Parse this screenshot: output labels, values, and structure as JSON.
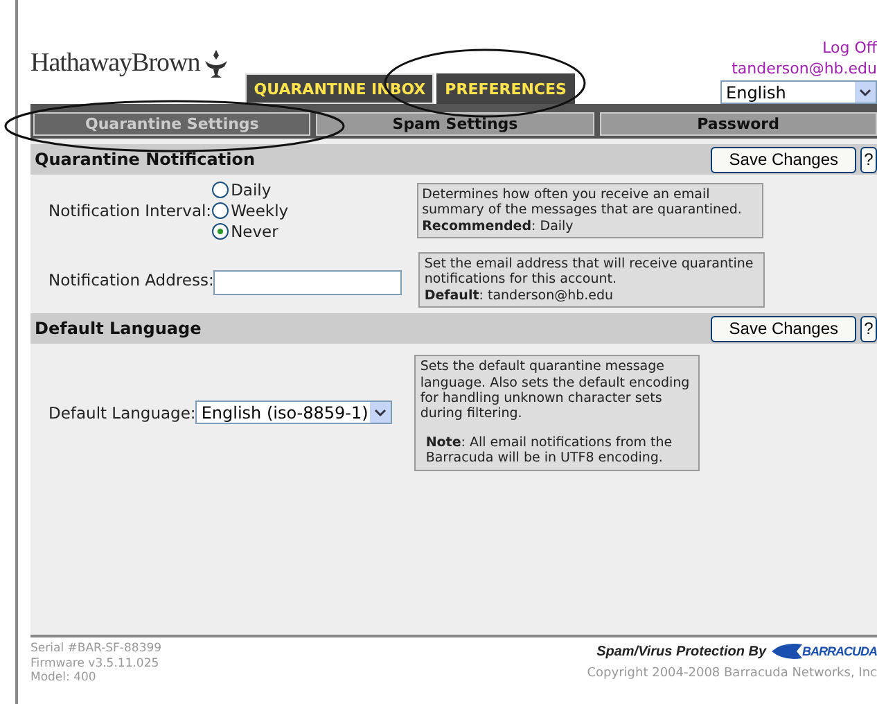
{
  "header": {
    "logo": "HathawayBrown",
    "main_tabs": [
      {
        "label": "QUARANTINE INBOX",
        "selected": false
      },
      {
        "label": "PREFERENCES",
        "selected": true
      }
    ],
    "log_off": "Log Off",
    "user": "tanderson@hb.edu",
    "language_select": "English"
  },
  "sub_tabs": [
    {
      "label": "Quarantine Settings",
      "selected": true
    },
    {
      "label": "Spam Settings",
      "selected": false
    },
    {
      "label": "Password",
      "selected": false
    }
  ],
  "sections": [
    {
      "title": "Quarantine Notification",
      "save_button": "Save Changes",
      "help_button": "?",
      "rows": [
        {
          "kind": "radio",
          "label": "Notification Interval:",
          "options": [
            {
              "label": "Daily",
              "selected": false
            },
            {
              "label": "Weekly",
              "selected": false
            },
            {
              "label": "Never",
              "selected": true
            }
          ],
          "help": "Determines how often you receive an email summary of the messages that are quarantined.",
          "help_note": "**Recommended**: Daily"
        },
        {
          "kind": "text",
          "label": "Notification Address:",
          "value": "",
          "help": "Set the email address that will receive quarantine notifications for this account.",
          "help_note": "**Default**: tanderson@hb.edu"
        }
      ]
    },
    {
      "title": "Default Language",
      "save_button": "Save Changes",
      "help_button": "?",
      "rows": [
        {
          "kind": "select",
          "label": "Default Language:",
          "value": "English (iso-8859-1)",
          "help": "Sets the default quarantine message language. Also sets the default encoding for handling unknown character sets during filtering.",
          "help_note": "**Note**: All email notifications from the Barracuda will be in UTF8 encoding."
        }
      ]
    }
  ],
  "footer": {
    "serial": "Serial #BAR-SF-88399",
    "firmware": "Firmware v3.5.11.025",
    "model": "Model: 400",
    "protection": "Spam/Virus Protection By",
    "vendor_logo": "BARRACUDA",
    "copyright": "Copyright 2004-2008 Barracuda Networks, Inc"
  }
}
